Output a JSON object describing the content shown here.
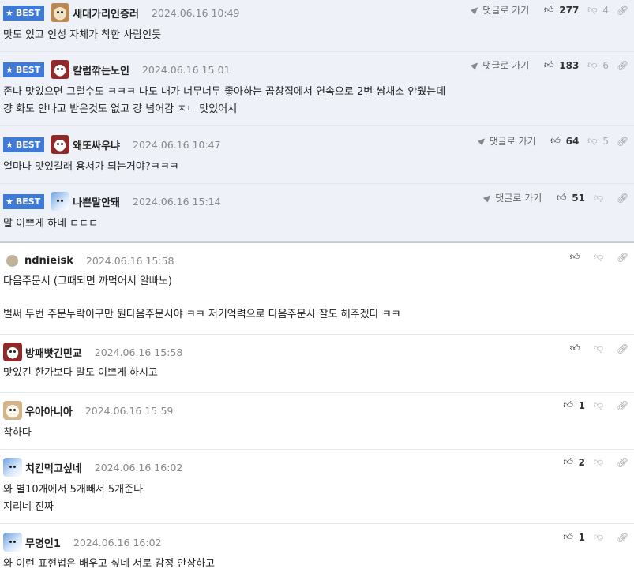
{
  "ui": {
    "best_label": "BEST",
    "reply_label": "댓글로 가기",
    "icons": {
      "like": "thumbs-up-icon",
      "dislike": "thumbs-down-icon",
      "link": "link-icon",
      "star": "star-icon"
    },
    "colors": {
      "best_bg": "#eef1f8",
      "badge": "#3f7ad6"
    }
  },
  "comments": [
    {
      "best": true,
      "nick": "새대가리인증러",
      "time": "2024.06.16 10:49",
      "likes": "277",
      "dislikes": "4",
      "lines": [
        "맛도 있고 인성 자체가 착한 사람인듯"
      ]
    },
    {
      "best": true,
      "nick": "칼럼깎는노인",
      "time": "2024.06.16 15:01",
      "likes": "183",
      "dislikes": "6",
      "lines": [
        "존나 맛있으면 그럴수도 ㅋㅋㅋ 나도 내가 너무너무 좋아하는 곱창집에서 연속으로 2번 쌈채소 안줬는데",
        "걍 화도 안나고 받은것도 없고 걍 넘어감 ㅈㄴ 맛있어서"
      ]
    },
    {
      "best": true,
      "nick": "왜또싸우냐",
      "time": "2024.06.16 10:47",
      "likes": "64",
      "dislikes": "5",
      "lines": [
        "얼마나 맛있길래 용서가 되는거야?ㅋㅋㅋ"
      ]
    },
    {
      "best": true,
      "nick": "나쁜말안돼",
      "time": "2024.06.16 15:14",
      "likes": "51",
      "dislikes": "",
      "lines": [
        "말 이쁘게 하네 ㄷㄷㄷ"
      ]
    },
    {
      "best": false,
      "nick": "ndnieisk",
      "time": "2024.06.16 15:58",
      "likes": "",
      "dislikes": "",
      "lines": [
        "다음주문시 (그때되면 까먹어서 알빠노)",
        "",
        "벌써 두번 주문누락이구만 뭔다음주문시야 ㅋㅋ 저기억력으로 다음주문시 잘도 해주겠다 ㅋㅋ"
      ]
    },
    {
      "best": false,
      "nick": "방패빳긴민교",
      "time": "2024.06.16 15:58",
      "likes": "",
      "dislikes": "",
      "lines": [
        "맛있긴 한가보다 말도 이쁘게 하시고"
      ]
    },
    {
      "best": false,
      "nick": "우아아니아",
      "time": "2024.06.16 15:59",
      "likes": "1",
      "dislikes": "",
      "lines": [
        "착하다"
      ]
    },
    {
      "best": false,
      "nick": "치킨먹고싶네",
      "time": "2024.06.16 16:02",
      "likes": "2",
      "dislikes": "",
      "lines": [
        "와 별10개에서 5개빼서 5개준다",
        "지리네 진짜"
      ]
    },
    {
      "best": false,
      "nick": "무명인1",
      "time": "2024.06.16 16:02",
      "likes": "1",
      "dislikes": "",
      "lines": [
        "와 이런 표현법은 배우고 싶네 서로 감정 안상하고"
      ]
    }
  ]
}
